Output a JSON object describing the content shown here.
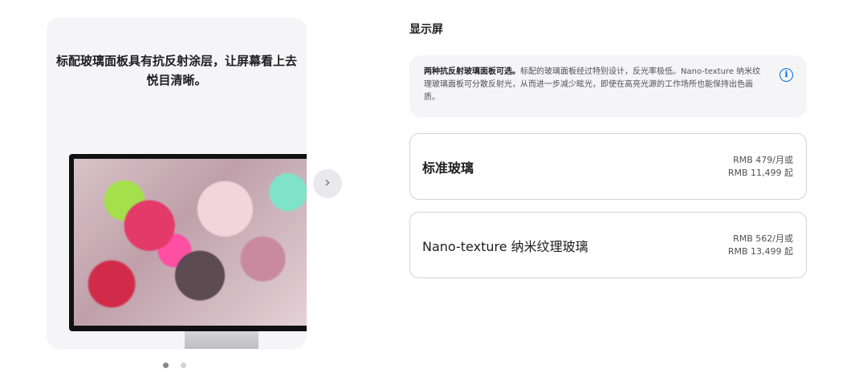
{
  "gallery": {
    "caption": "标配玻璃面板具有抗反射涂层，让屏幕看上去悦目清晰。",
    "next_icon": "chevron-right-icon",
    "dots_total": 2,
    "dots_active": 1
  },
  "display": {
    "title": "显示屏",
    "info": {
      "bold": "两种抗反射玻璃面板可选。",
      "text": "标配的玻璃面板经过特别设计，反光率极低。Nano-texture 纳米纹理玻璃面板可分散反射光，从而进一步减少眩光，即使在高亮光源的工作场所也能保持出色画质。",
      "icon": "info-icon"
    },
    "options": [
      {
        "name": "标准玻璃",
        "price_monthly": "RMB 479/月或",
        "price_full": "RMB 11,499 起"
      },
      {
        "name": "Nano-texture 纳米纹理玻璃",
        "price_monthly": "RMB 562/月或",
        "price_full": "RMB 13,499 起"
      }
    ]
  },
  "colors": {
    "accent": "#0071e3",
    "card_bg": "#f5f5f7",
    "border": "#d2d2d7"
  }
}
